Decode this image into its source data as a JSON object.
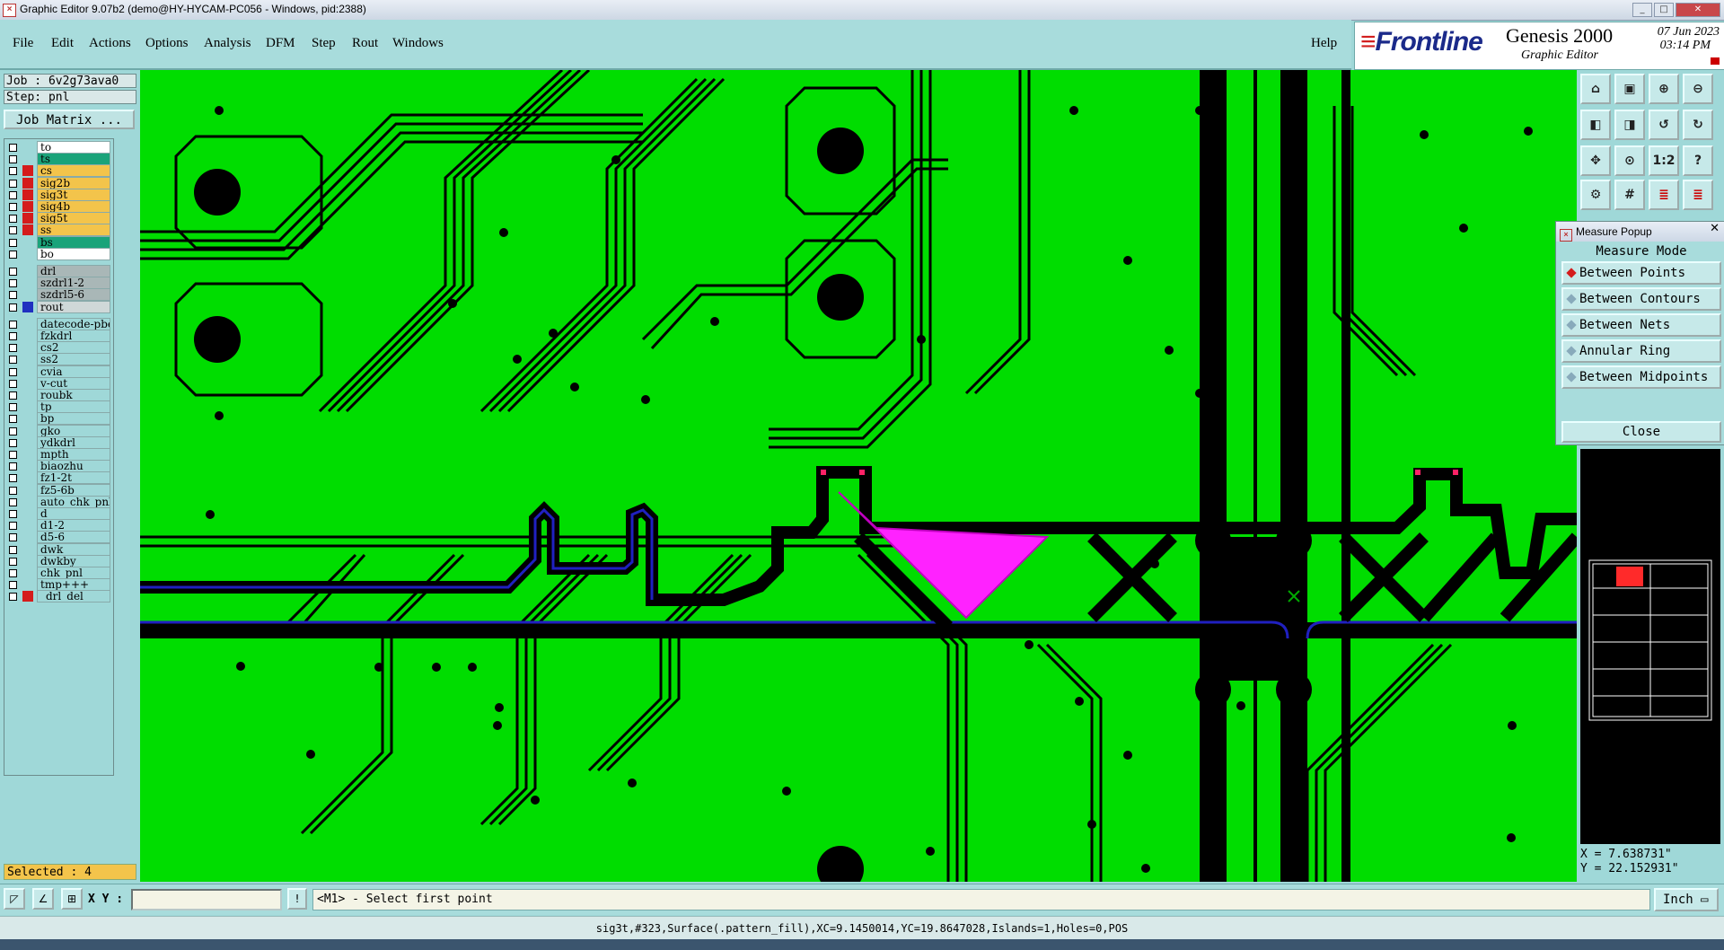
{
  "window": {
    "title": "Graphic Editor 9.07b2 (demo@HY-HYCAM-PC056 - Windows, pid:2388)"
  },
  "menu": [
    "File",
    "Edit",
    "Actions",
    "Options",
    "Analysis",
    "DFM",
    "Step",
    "Rout",
    "Windows"
  ],
  "help_label": "Help",
  "brand": {
    "logo": "Frontline",
    "product": "Genesis 2000",
    "subtitle": "Graphic Editor",
    "date": "07 Jun 2023",
    "time": "03:14 PM"
  },
  "job": {
    "job_label": "Job : 6v2g73ava0",
    "step_label": "Step: pnl",
    "matrix_button": "Job Matrix ..."
  },
  "layers": [
    {
      "name": "to",
      "color": "#ffffff",
      "mark": "#000000"
    },
    {
      "name": "ts",
      "color": "#1aa37a",
      "mark": "#000000"
    },
    {
      "name": "cs",
      "color": "#f3c44b",
      "mark": "#d41c1c"
    },
    {
      "name": "sig2b",
      "color": "#f3c44b",
      "mark": "#d41c1c"
    },
    {
      "name": "sig3t",
      "color": "#f3c44b",
      "mark": "#d41c1c"
    },
    {
      "name": "sig4b",
      "color": "#f3c44b",
      "mark": "#d41c1c"
    },
    {
      "name": "sig5t",
      "color": "#f3c44b",
      "mark": "#d41c1c"
    },
    {
      "name": "ss",
      "color": "#f3c44b",
      "mark": "#d41c1c"
    },
    {
      "name": "bs",
      "color": "#1aa37a",
      "mark": "#000000"
    },
    {
      "name": "bo",
      "color": "#ffffff",
      "mark": "#000000"
    },
    {
      "name": "drl",
      "color": "#a9b7b7",
      "mark": "#000000"
    },
    {
      "name": "szdrl1-2",
      "color": "#a9b7b7",
      "mark": "#000000"
    },
    {
      "name": "szdrl5-6",
      "color": "#a9b7b7",
      "mark": "#000000"
    },
    {
      "name": "rout",
      "color": "#cfd8d8",
      "mark": "#2030c0"
    },
    {
      "name": "datecode-pbe",
      "color": "#9fd8d8",
      "mark": "#000000"
    },
    {
      "name": "fzkdrl",
      "color": "#9fd8d8",
      "mark": "#000000"
    },
    {
      "name": "cs2",
      "color": "#9fd8d8",
      "mark": "#000000"
    },
    {
      "name": "ss2",
      "color": "#9fd8d8",
      "mark": "#000000"
    },
    {
      "name": "cvia",
      "color": "#9fd8d8",
      "mark": "#000000"
    },
    {
      "name": "v-cut",
      "color": "#9fd8d8",
      "mark": "#000000"
    },
    {
      "name": "roubk",
      "color": "#9fd8d8",
      "mark": "#000000"
    },
    {
      "name": "tp",
      "color": "#9fd8d8",
      "mark": "#000000"
    },
    {
      "name": "bp",
      "color": "#9fd8d8",
      "mark": "#000000"
    },
    {
      "name": "gko",
      "color": "#9fd8d8",
      "mark": "#000000"
    },
    {
      "name": "ydkdrl",
      "color": "#9fd8d8",
      "mark": "#000000"
    },
    {
      "name": "mpth",
      "color": "#9fd8d8",
      "mark": "#000000"
    },
    {
      "name": "biaozhu",
      "color": "#9fd8d8",
      "mark": "#000000"
    },
    {
      "name": "fz1-2t",
      "color": "#9fd8d8",
      "mark": "#000000"
    },
    {
      "name": "fz5-6b",
      "color": "#9fd8d8",
      "mark": "#000000"
    },
    {
      "name": "auto_chk_pnl",
      "color": "#9fd8d8",
      "mark": "#000000"
    },
    {
      "name": "d",
      "color": "#9fd8d8",
      "mark": "#000000"
    },
    {
      "name": "d1-2",
      "color": "#9fd8d8",
      "mark": "#000000"
    },
    {
      "name": "d5-6",
      "color": "#9fd8d8",
      "mark": "#000000"
    },
    {
      "name": "dwk",
      "color": "#9fd8d8",
      "mark": "#000000"
    },
    {
      "name": "dwkby",
      "color": "#9fd8d8",
      "mark": "#000000"
    },
    {
      "name": "chk_pnl",
      "color": "#9fd8d8",
      "mark": "#000000"
    },
    {
      "name": "tmp+++",
      "color": "#9fd8d8",
      "mark": "#000000"
    },
    {
      "name": "_drl_del",
      "color": "#9fd8d8",
      "mark": "#d41c1c"
    }
  ],
  "selected_label": "Selected : 4",
  "measure": {
    "title": "Measure Popup",
    "mode_label": "Measure Mode",
    "options": [
      "Between Points",
      "Between Contours",
      "Between Nets",
      "Annular Ring",
      "Between Midpoints"
    ],
    "active_option": "Between Points",
    "close_label": "Close"
  },
  "toolbar_icons": [
    "home-icon",
    "fit-icon",
    "zoom-in-icon",
    "zoom-out-icon",
    "pan-icon",
    "redraw-icon",
    "one-to-one-icon",
    "help-icon"
  ],
  "coords": {
    "x": "X = 7.638731\"",
    "y": "Y = 22.152931\""
  },
  "bottom": {
    "xy_label": "X Y :",
    "xy_value": "",
    "prompt": "<M1> - Select first point",
    "unit": "Inch"
  },
  "status": "sig3t,#323,Surface(.pattern_fill),XC=9.1450014,YC=19.8647028,Islands=1,Holes=0,POS",
  "colors": {
    "board": "#00dd00",
    "trace": "#000000",
    "selection": "#ff22ff",
    "outline": "#2020c0",
    "panel": "#9fd8d8"
  }
}
